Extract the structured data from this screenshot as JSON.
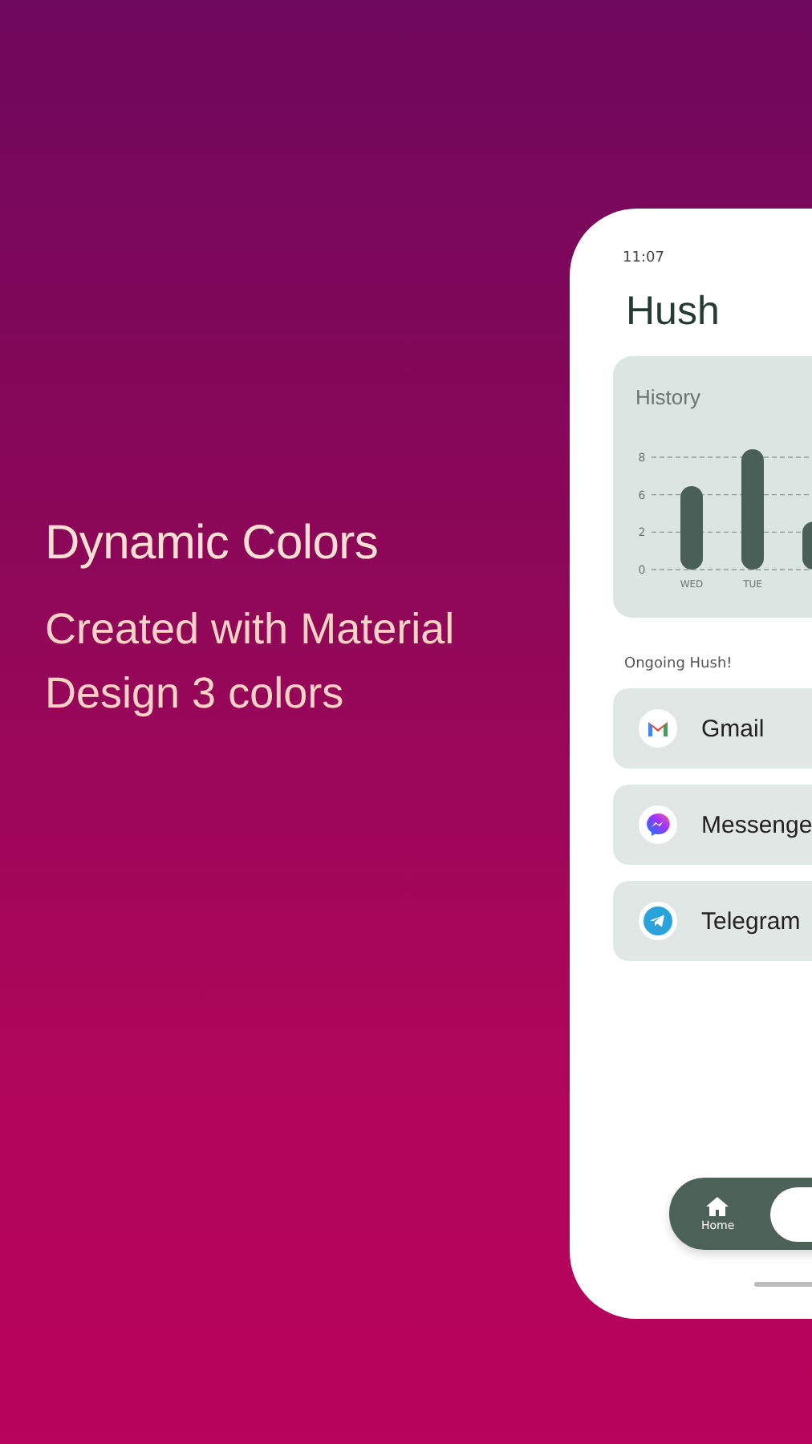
{
  "headline": "Dynamic Colors",
  "subheadline": "Created with Material Design 3 colors",
  "phone": {
    "status_time": "11:07",
    "app_title": "Hush",
    "history_card": {
      "title": "History",
      "y_labels": [
        "8",
        "6",
        "2",
        "0"
      ],
      "x_labels": [
        "WED",
        "TUE"
      ]
    },
    "section_label": "Ongoing Hush!",
    "apps": [
      {
        "name": "Gmail",
        "kind": "gmail"
      },
      {
        "name": "Messenge",
        "kind": "messenger"
      },
      {
        "name": "Telegram",
        "kind": "telegram"
      }
    ],
    "nav": [
      {
        "label": "Home",
        "kind": "home"
      }
    ]
  }
}
